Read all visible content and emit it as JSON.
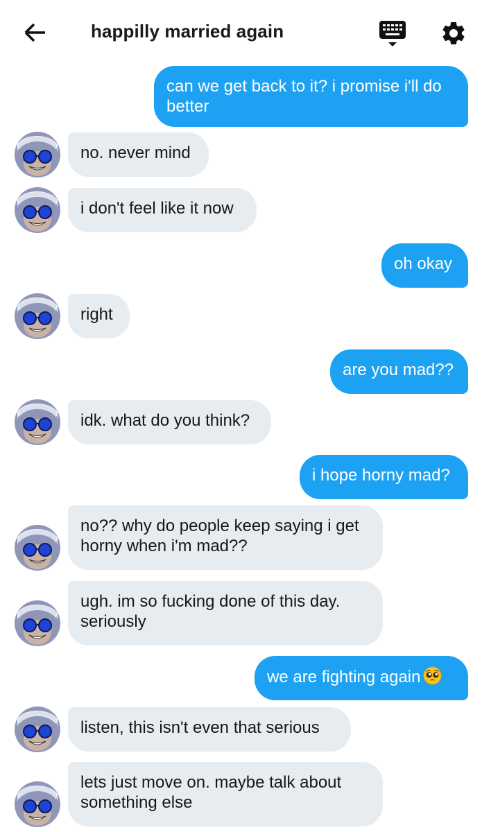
{
  "header": {
    "title": "happilly married again",
    "back_icon": "arrow-left-icon",
    "keyboard_icon": "keyboard-icon",
    "settings_icon": "gear-icon"
  },
  "colors": {
    "outgoing_bubble": "#1da1f2",
    "incoming_bubble": "#e6ecf0",
    "outgoing_text": "#ffffff",
    "incoming_text": "#14171a"
  },
  "messages": [
    {
      "direction": "out",
      "text": "can we get back to it? i promise i'll do better"
    },
    {
      "direction": "in",
      "text": "no. never mind"
    },
    {
      "direction": "in",
      "text": "i don't feel like it now"
    },
    {
      "direction": "out",
      "text": "oh okay"
    },
    {
      "direction": "in",
      "text": "right"
    },
    {
      "direction": "out",
      "text": "are you mad??"
    },
    {
      "direction": "in",
      "text": "idk. what do you think?"
    },
    {
      "direction": "out",
      "text": "i hope horny mad?"
    },
    {
      "direction": "in",
      "text": "no?? why do people keep saying i get horny when i'm mad??"
    },
    {
      "direction": "in",
      "text": "ugh. im so fucking done of this day. seriously"
    },
    {
      "direction": "out",
      "text": "we are fighting again",
      "emoji": "pleading-face-emoji"
    },
    {
      "direction": "in",
      "text": "listen, this isn't even that serious"
    },
    {
      "direction": "in",
      "text": "lets just move on. maybe talk about something else"
    }
  ]
}
